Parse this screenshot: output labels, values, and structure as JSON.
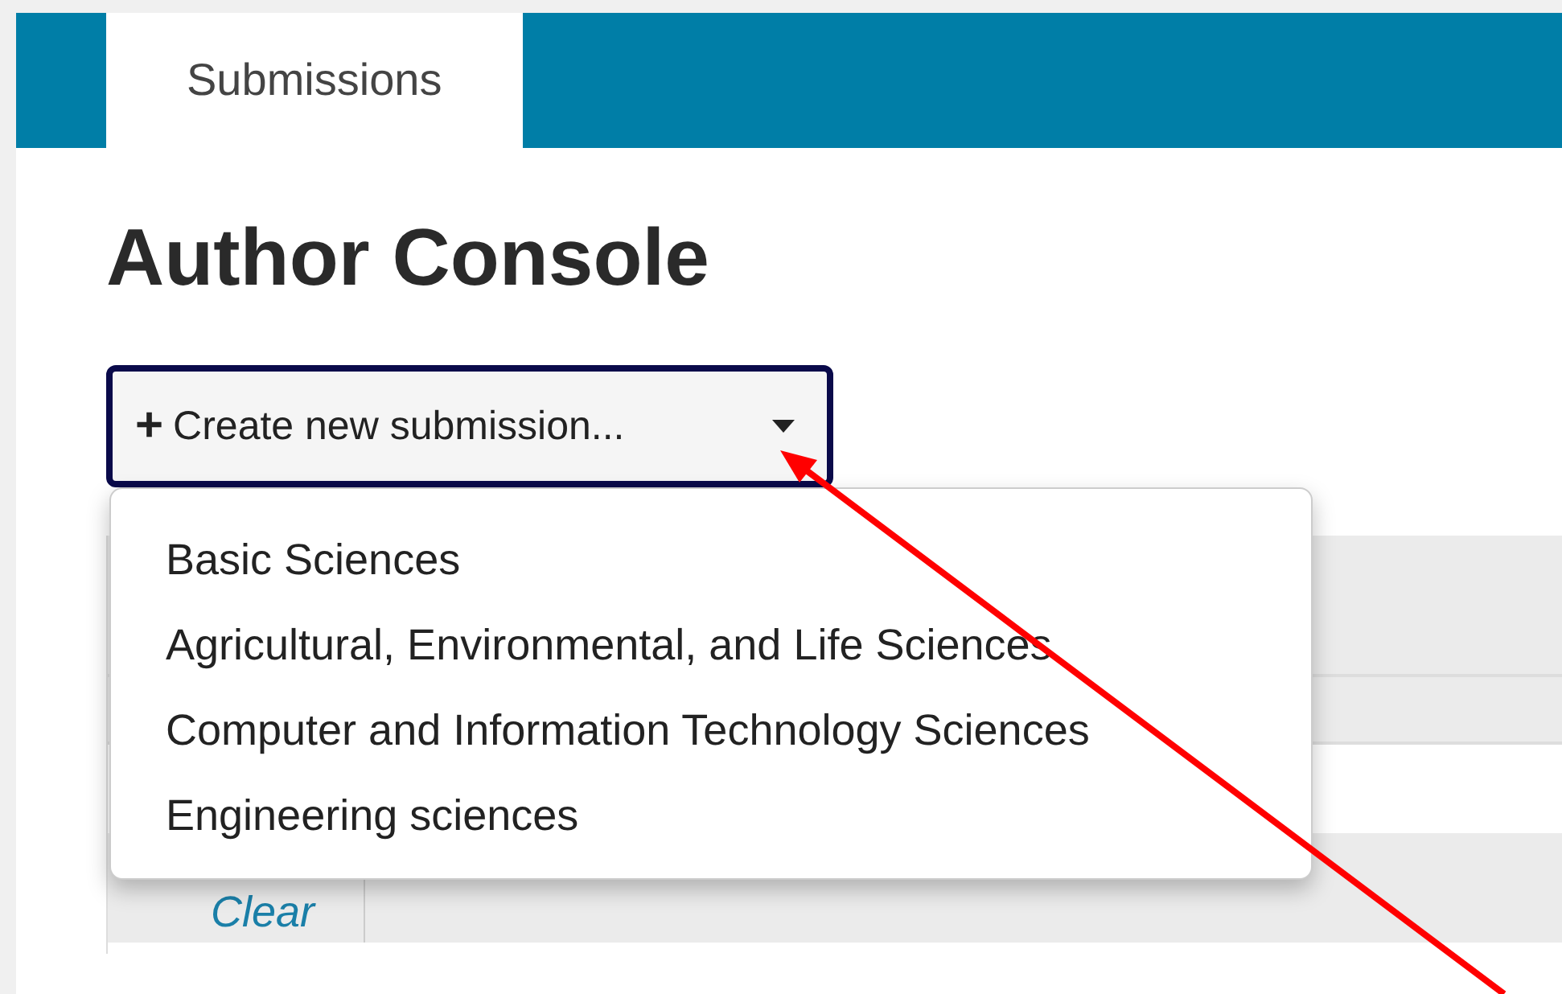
{
  "tabs": [
    {
      "label": "Submissions",
      "selected": true
    }
  ],
  "page_title": "Author Console",
  "create_button": {
    "plus": "+",
    "label": "Create new submission...",
    "expanded": true
  },
  "dropdown_menu": {
    "items": [
      "Basic Sciences",
      "Agricultural, Environmental, and Life Sciences",
      "Computer and Information Technology Sciences",
      "Engineering sciences"
    ]
  },
  "table": {
    "clear_link": "Clear"
  }
}
